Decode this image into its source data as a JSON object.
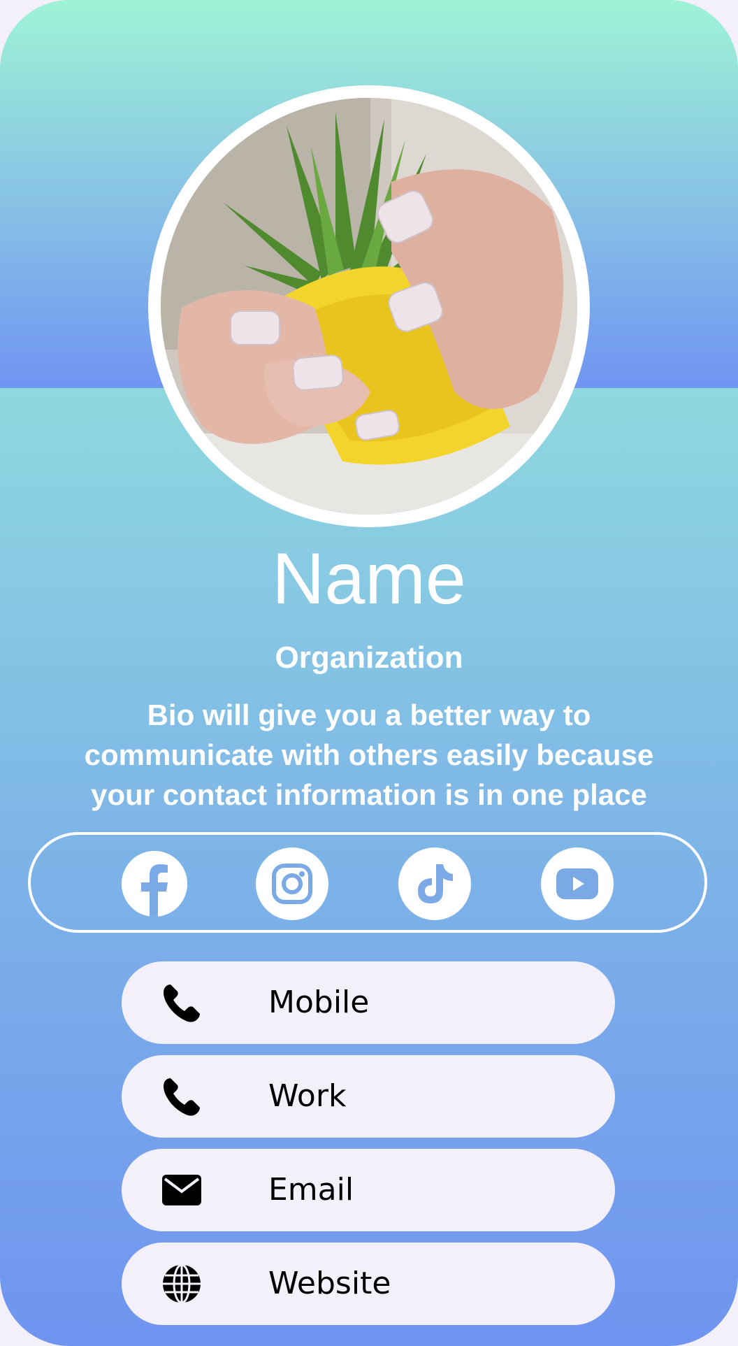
{
  "profile": {
    "name": "Name",
    "organization": "Organization",
    "bio": "Bio will give you a better way to communicate with others easily because your contact information is in one place"
  },
  "avatar": {
    "icon": "avatar-photo"
  },
  "social": [
    {
      "network": "facebook",
      "icon": "facebook-icon"
    },
    {
      "network": "instagram",
      "icon": "instagram-icon"
    },
    {
      "network": "tiktok",
      "icon": "tiktok-icon"
    },
    {
      "network": "youtube",
      "icon": "youtube-icon"
    }
  ],
  "contacts": [
    {
      "label": "Mobile",
      "icon": "phone-icon"
    },
    {
      "label": "Work",
      "icon": "phone-icon"
    },
    {
      "label": "Email",
      "icon": "envelope-icon"
    },
    {
      "label": "Website",
      "icon": "globe-icon"
    }
  ],
  "colors": {
    "header_top": "#9ef3d6",
    "header_bottom": "#6f94f2",
    "body_top": "#8fd8e0",
    "body_bottom": "#6f94f0",
    "social_icon": "#7ba9e6",
    "button_bg": "#f3f0fa"
  }
}
